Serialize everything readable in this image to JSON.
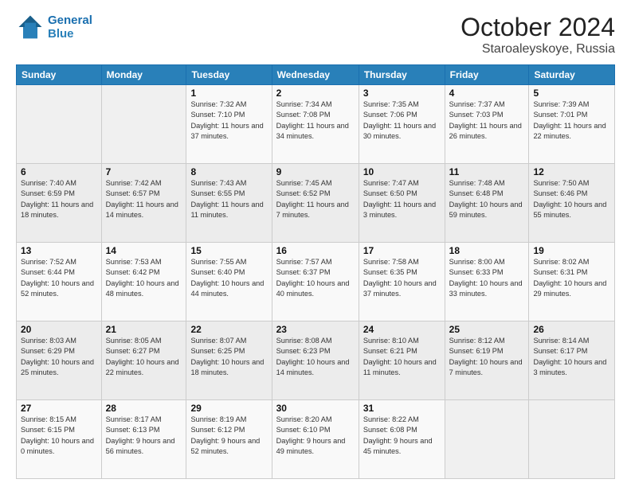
{
  "header": {
    "logo_line1": "General",
    "logo_line2": "Blue",
    "month": "October 2024",
    "location": "Staroaleyskoye, Russia"
  },
  "days_of_week": [
    "Sunday",
    "Monday",
    "Tuesday",
    "Wednesday",
    "Thursday",
    "Friday",
    "Saturday"
  ],
  "weeks": [
    [
      {
        "day": "",
        "info": ""
      },
      {
        "day": "",
        "info": ""
      },
      {
        "day": "1",
        "info": "Sunrise: 7:32 AM\nSunset: 7:10 PM\nDaylight: 11 hours and 37 minutes."
      },
      {
        "day": "2",
        "info": "Sunrise: 7:34 AM\nSunset: 7:08 PM\nDaylight: 11 hours and 34 minutes."
      },
      {
        "day": "3",
        "info": "Sunrise: 7:35 AM\nSunset: 7:06 PM\nDaylight: 11 hours and 30 minutes."
      },
      {
        "day": "4",
        "info": "Sunrise: 7:37 AM\nSunset: 7:03 PM\nDaylight: 11 hours and 26 minutes."
      },
      {
        "day": "5",
        "info": "Sunrise: 7:39 AM\nSunset: 7:01 PM\nDaylight: 11 hours and 22 minutes."
      }
    ],
    [
      {
        "day": "6",
        "info": "Sunrise: 7:40 AM\nSunset: 6:59 PM\nDaylight: 11 hours and 18 minutes."
      },
      {
        "day": "7",
        "info": "Sunrise: 7:42 AM\nSunset: 6:57 PM\nDaylight: 11 hours and 14 minutes."
      },
      {
        "day": "8",
        "info": "Sunrise: 7:43 AM\nSunset: 6:55 PM\nDaylight: 11 hours and 11 minutes."
      },
      {
        "day": "9",
        "info": "Sunrise: 7:45 AM\nSunset: 6:52 PM\nDaylight: 11 hours and 7 minutes."
      },
      {
        "day": "10",
        "info": "Sunrise: 7:47 AM\nSunset: 6:50 PM\nDaylight: 11 hours and 3 minutes."
      },
      {
        "day": "11",
        "info": "Sunrise: 7:48 AM\nSunset: 6:48 PM\nDaylight: 10 hours and 59 minutes."
      },
      {
        "day": "12",
        "info": "Sunrise: 7:50 AM\nSunset: 6:46 PM\nDaylight: 10 hours and 55 minutes."
      }
    ],
    [
      {
        "day": "13",
        "info": "Sunrise: 7:52 AM\nSunset: 6:44 PM\nDaylight: 10 hours and 52 minutes."
      },
      {
        "day": "14",
        "info": "Sunrise: 7:53 AM\nSunset: 6:42 PM\nDaylight: 10 hours and 48 minutes."
      },
      {
        "day": "15",
        "info": "Sunrise: 7:55 AM\nSunset: 6:40 PM\nDaylight: 10 hours and 44 minutes."
      },
      {
        "day": "16",
        "info": "Sunrise: 7:57 AM\nSunset: 6:37 PM\nDaylight: 10 hours and 40 minutes."
      },
      {
        "day": "17",
        "info": "Sunrise: 7:58 AM\nSunset: 6:35 PM\nDaylight: 10 hours and 37 minutes."
      },
      {
        "day": "18",
        "info": "Sunrise: 8:00 AM\nSunset: 6:33 PM\nDaylight: 10 hours and 33 minutes."
      },
      {
        "day": "19",
        "info": "Sunrise: 8:02 AM\nSunset: 6:31 PM\nDaylight: 10 hours and 29 minutes."
      }
    ],
    [
      {
        "day": "20",
        "info": "Sunrise: 8:03 AM\nSunset: 6:29 PM\nDaylight: 10 hours and 25 minutes."
      },
      {
        "day": "21",
        "info": "Sunrise: 8:05 AM\nSunset: 6:27 PM\nDaylight: 10 hours and 22 minutes."
      },
      {
        "day": "22",
        "info": "Sunrise: 8:07 AM\nSunset: 6:25 PM\nDaylight: 10 hours and 18 minutes."
      },
      {
        "day": "23",
        "info": "Sunrise: 8:08 AM\nSunset: 6:23 PM\nDaylight: 10 hours and 14 minutes."
      },
      {
        "day": "24",
        "info": "Sunrise: 8:10 AM\nSunset: 6:21 PM\nDaylight: 10 hours and 11 minutes."
      },
      {
        "day": "25",
        "info": "Sunrise: 8:12 AM\nSunset: 6:19 PM\nDaylight: 10 hours and 7 minutes."
      },
      {
        "day": "26",
        "info": "Sunrise: 8:14 AM\nSunset: 6:17 PM\nDaylight: 10 hours and 3 minutes."
      }
    ],
    [
      {
        "day": "27",
        "info": "Sunrise: 8:15 AM\nSunset: 6:15 PM\nDaylight: 10 hours and 0 minutes."
      },
      {
        "day": "28",
        "info": "Sunrise: 8:17 AM\nSunset: 6:13 PM\nDaylight: 9 hours and 56 minutes."
      },
      {
        "day": "29",
        "info": "Sunrise: 8:19 AM\nSunset: 6:12 PM\nDaylight: 9 hours and 52 minutes."
      },
      {
        "day": "30",
        "info": "Sunrise: 8:20 AM\nSunset: 6:10 PM\nDaylight: 9 hours and 49 minutes."
      },
      {
        "day": "31",
        "info": "Sunrise: 8:22 AM\nSunset: 6:08 PM\nDaylight: 9 hours and 45 minutes."
      },
      {
        "day": "",
        "info": ""
      },
      {
        "day": "",
        "info": ""
      }
    ]
  ]
}
